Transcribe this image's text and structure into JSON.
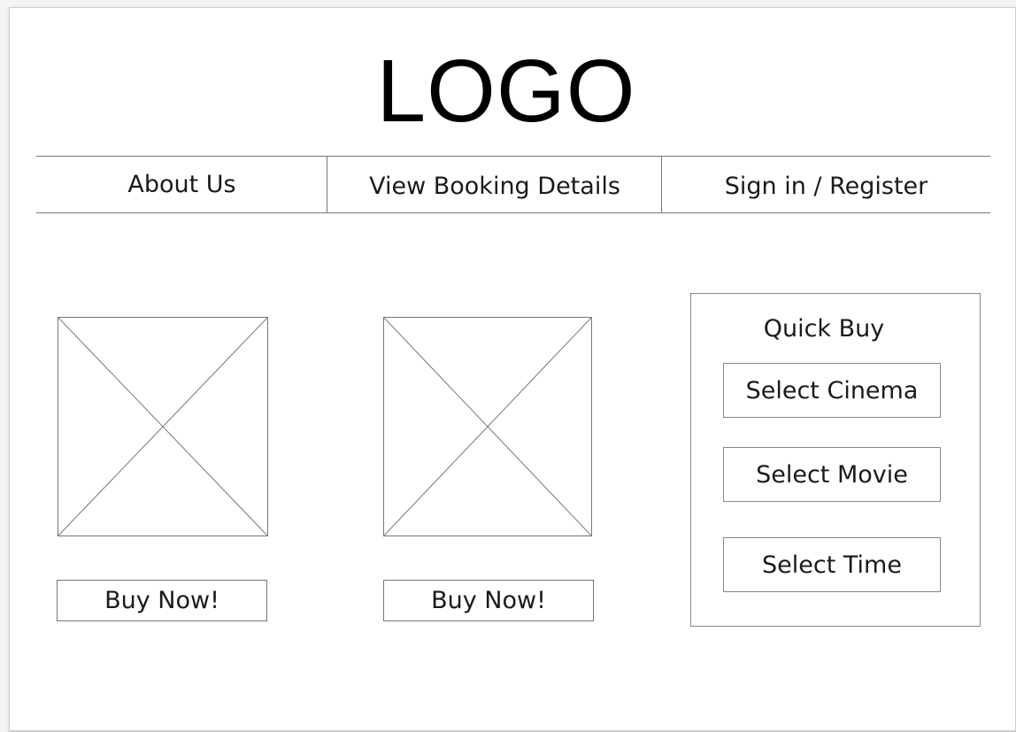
{
  "header": {
    "logo_text": "LOGO"
  },
  "nav": {
    "items": [
      {
        "label": "About Us"
      },
      {
        "label": "View Booking Details"
      },
      {
        "label": "Sign in / Register"
      }
    ]
  },
  "products": [
    {
      "image_icon": "image-placeholder-icon",
      "button_label": "Buy Now!"
    },
    {
      "image_icon": "image-placeholder-icon",
      "button_label": "Buy Now!"
    }
  ],
  "quick_buy": {
    "title": "Quick Buy",
    "selects": [
      {
        "label": "Select Cinema"
      },
      {
        "label": "Select Movie"
      },
      {
        "label": "Select Time"
      }
    ]
  },
  "colors": {
    "line": "#777777",
    "text": "#1a1a1a",
    "background": "#ffffff"
  }
}
